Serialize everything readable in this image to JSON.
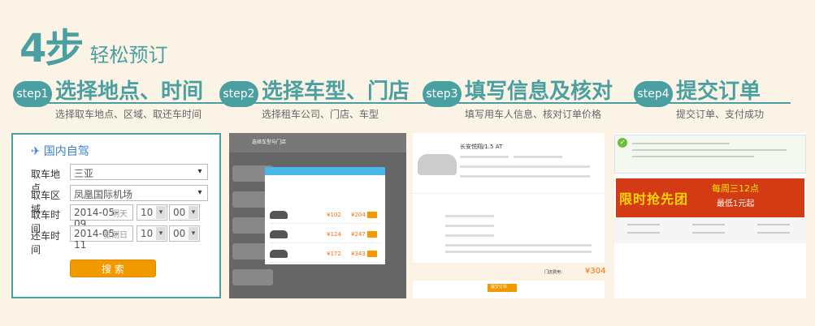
{
  "header": {
    "big": "4步",
    "sub": "轻松预订"
  },
  "steps": [
    {
      "pill": "step1",
      "title": "选择地点、时间",
      "desc": "选择取车地点、区域、取还车时间"
    },
    {
      "pill": "step2",
      "title": "选择车型、门店",
      "desc": "选择租车公司、门店、车型"
    },
    {
      "pill": "step3",
      "title": "填写信息及核对",
      "desc": "填写用车人信息、核对订单价格"
    },
    {
      "pill": "step4",
      "title": "提交订单",
      "desc": "提交订单、支付成功"
    }
  ],
  "form": {
    "heading": "国内自驾",
    "pickup_place_label": "取车地点",
    "pickup_place_value": "三亚",
    "area_label": "取车区域",
    "area_value": "凤凰国际机场",
    "pickup_time_label": "取车时间",
    "pickup_date": "2014-05-09",
    "pickup_day_hint": "明天",
    "pickup_hour": "10",
    "pickup_min": "00",
    "return_time_label": "还车时间",
    "return_date": "2014-05-11",
    "return_day_hint": "星期日",
    "return_hour": "10",
    "return_min": "00",
    "search_button": "搜 索"
  },
  "panel2": {
    "tags": [
      "选择车型与门店"
    ],
    "prices": [
      "¥102",
      "¥204",
      "¥124",
      "¥247",
      "¥172",
      "¥343"
    ]
  },
  "panel3": {
    "car_title": "长安悦翔/1.5 AT",
    "total_label": "门店费用：",
    "total": "¥304",
    "submit": "提交订单"
  },
  "panel4": {
    "banner_main": "限时抢先团",
    "banner_side": "每周三12点",
    "banner_price": "最低1元起"
  },
  "colors": {
    "teal": "#4a9fa0",
    "orange": "#f29900",
    "price": "#ff6a00",
    "background": "#fbf3e6"
  }
}
